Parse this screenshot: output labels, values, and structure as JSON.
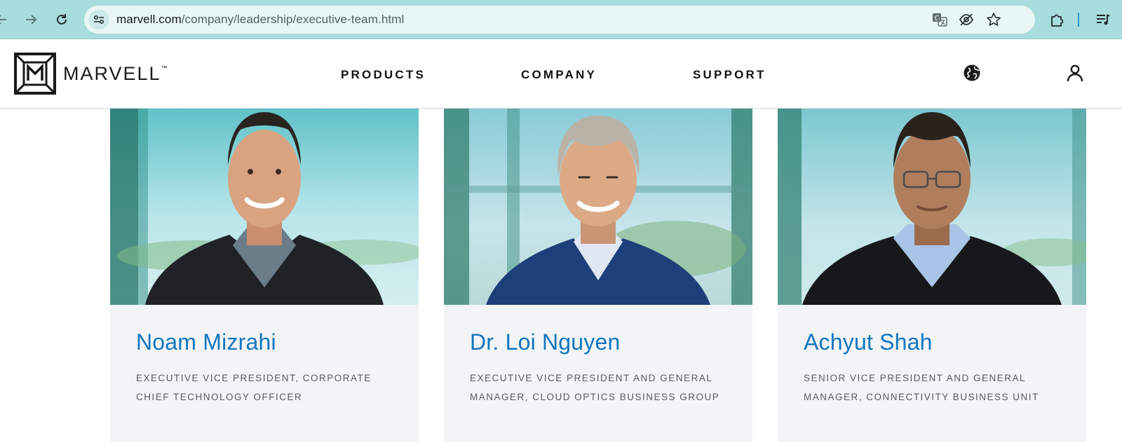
{
  "browser": {
    "url_host": "marvell.com",
    "url_path": "/company/leadership/executive-team.html"
  },
  "header": {
    "logo_text": "MARVELL",
    "logo_mark": "™",
    "nav": [
      "PRODUCTS",
      "COMPANY",
      "SUPPORT"
    ]
  },
  "executives": [
    {
      "name": "Noam Mizrahi",
      "title": "EXECUTIVE VICE PRESIDENT, CORPORATE CHIEF TECHNOLOGY OFFICER"
    },
    {
      "name": "Dr. Loi Nguyen",
      "title": "EXECUTIVE VICE PRESIDENT AND GENERAL MANAGER, CLOUD OPTICS BUSINESS GROUP"
    },
    {
      "name": "Achyut Shah",
      "title": "SENIOR VICE PRESIDENT AND GENERAL MANAGER, CONNECTIVITY BUSINESS UNIT"
    }
  ],
  "colors": {
    "browser_bar": "#a8dcdf",
    "name_accent": "#1076c0",
    "card_bg": "#f3f4f6"
  },
  "icons": [
    "back-arrow-icon",
    "forward-arrow-icon",
    "reload-icon",
    "site-info-icon",
    "translate-icon",
    "tracking-protection-icon",
    "bookmark-star-icon",
    "extensions-icon",
    "media-queue-icon",
    "globe-icon",
    "user-account-icon"
  ]
}
